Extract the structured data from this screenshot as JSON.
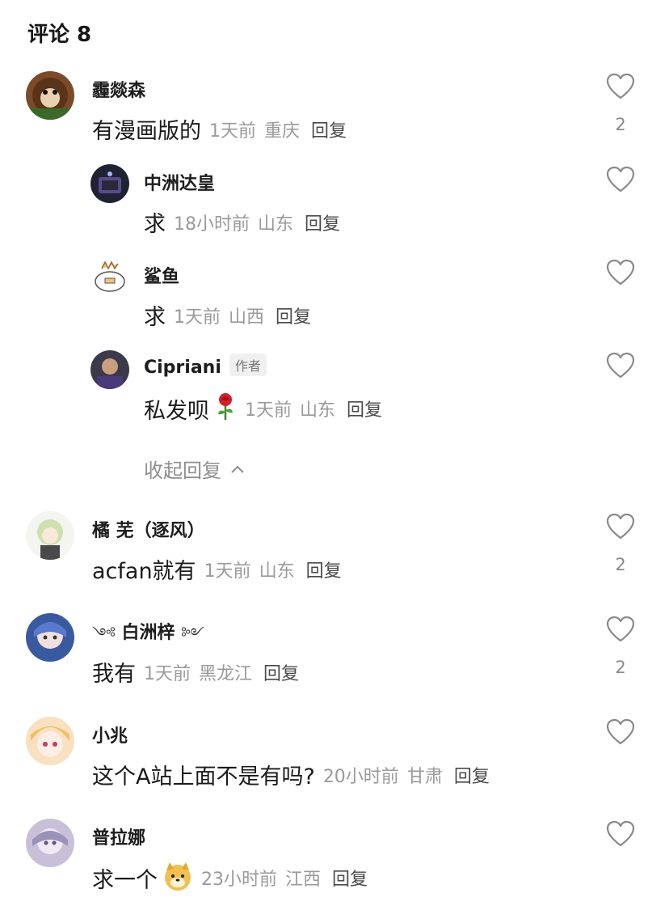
{
  "header": {
    "title": "评论 8"
  },
  "comments": [
    {
      "name": "霾燚森",
      "text": "有漫画版的",
      "time": "1天前",
      "location": "重庆",
      "reply": "回复",
      "likes": "2"
    },
    {
      "name": "中洲达皇",
      "text": "求",
      "time": "18小时前",
      "location": "山东",
      "reply": "回复"
    },
    {
      "name": "鲨鱼",
      "text": "求",
      "time": "1天前",
      "location": "山西",
      "reply": "回复"
    },
    {
      "name": "Cipriani",
      "badge": "作者",
      "text": "私发呗",
      "emoji": "rose",
      "time": "1天前",
      "location": "山东",
      "reply": "回复"
    },
    {
      "name": "橘 芜（逐风）",
      "text": "acfan就有",
      "time": "1天前",
      "location": "山东",
      "reply": "回复",
      "likes": "2"
    },
    {
      "name": "白洲梓",
      "name_decor_left": "༺",
      "name_decor_right": "༻",
      "text": "我有",
      "time": "1天前",
      "location": "黑龙江",
      "reply": "回复",
      "likes": "2"
    },
    {
      "name": "小兆",
      "text": "这个A站上面不是有吗?",
      "time": "20小时前",
      "location": "甘肃",
      "reply": "回复"
    },
    {
      "name": "普拉娜",
      "text": "求一个",
      "emoji": "doge",
      "time": "23小时前",
      "location": "江西",
      "reply": "回复"
    }
  ],
  "collapse_label": "收起回复",
  "icons": {
    "like": "heart-outline-icon",
    "collapse": "chevron-up-icon"
  },
  "colors": {
    "meta": "#9a9a9a",
    "icon": "#8a8a8a"
  }
}
